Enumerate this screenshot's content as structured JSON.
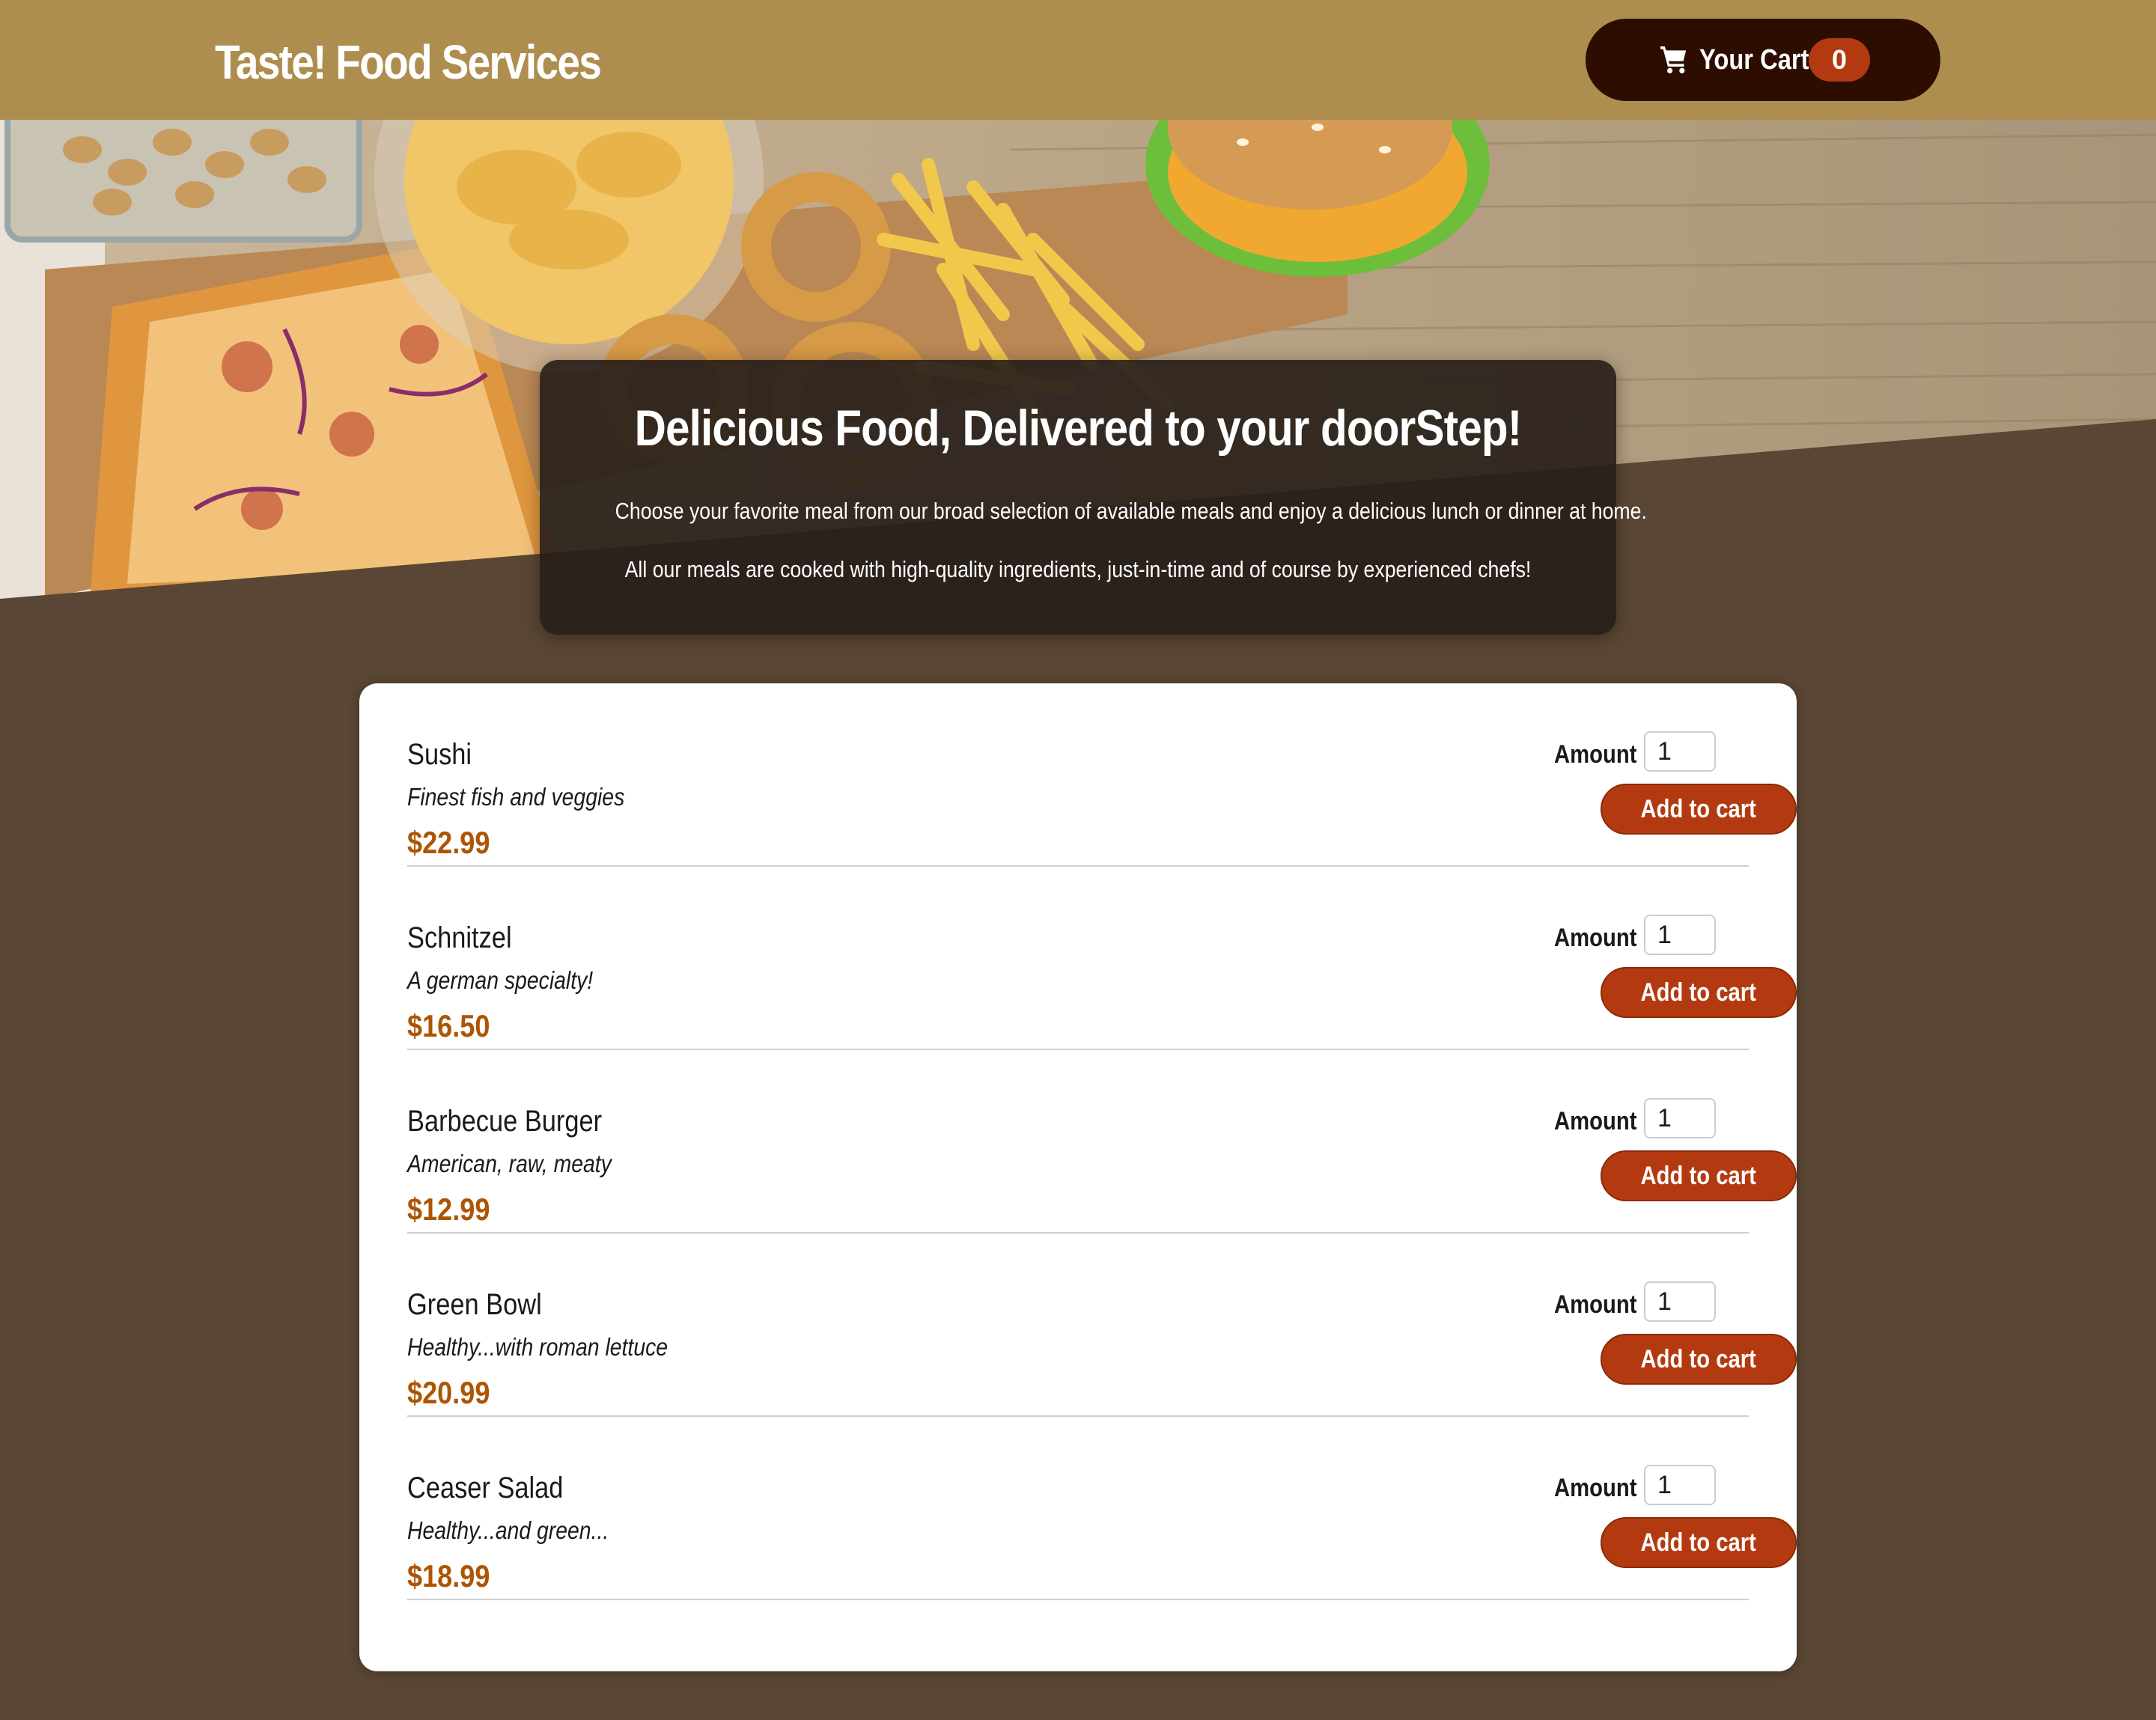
{
  "header": {
    "brand": "Taste! Food Services",
    "cart_label": "Your Cart",
    "cart_count": "0"
  },
  "summary": {
    "title": "Delicious Food, Delivered to your doorStep!",
    "paragraph1": "Choose your favorite meal from our broad selection of available meals and enjoy a delicious lunch or dinner at home.",
    "paragraph2": "All our meals are cooked with high-quality ingredients, just-in-time and of course by experienced chefs!"
  },
  "meals": [
    {
      "name": "Sushi",
      "description": "Finest fish and veggies",
      "price": "$22.99",
      "amount_label": "Amount",
      "amount_value": "1",
      "button_label": "Add to cart"
    },
    {
      "name": "Schnitzel",
      "description": "A german specialty!",
      "price": "$16.50",
      "amount_label": "Amount",
      "amount_value": "1",
      "button_label": "Add to cart"
    },
    {
      "name": "Barbecue Burger",
      "description": "American, raw, meaty",
      "price": "$12.99",
      "amount_label": "Amount",
      "amount_value": "1",
      "button_label": "Add to cart"
    },
    {
      "name": "Green Bowl",
      "description": "Healthy...with roman lettuce",
      "price": "$20.99",
      "amount_label": "Amount",
      "amount_value": "1",
      "button_label": "Add to cart"
    },
    {
      "name": "Ceaser Salad",
      "description": "Healthy...and green...",
      "price": "$18.99",
      "amount_label": "Amount",
      "amount_value": "1",
      "button_label": "Add to cart"
    }
  ],
  "icons": {
    "cart": "shopping-cart-icon"
  },
  "colors": {
    "header_bg": "#ad8e4f",
    "page_bg": "#5a4634",
    "cart_button_bg": "#2c0d00",
    "accent": "#b33a10",
    "price": "#ad5502"
  }
}
